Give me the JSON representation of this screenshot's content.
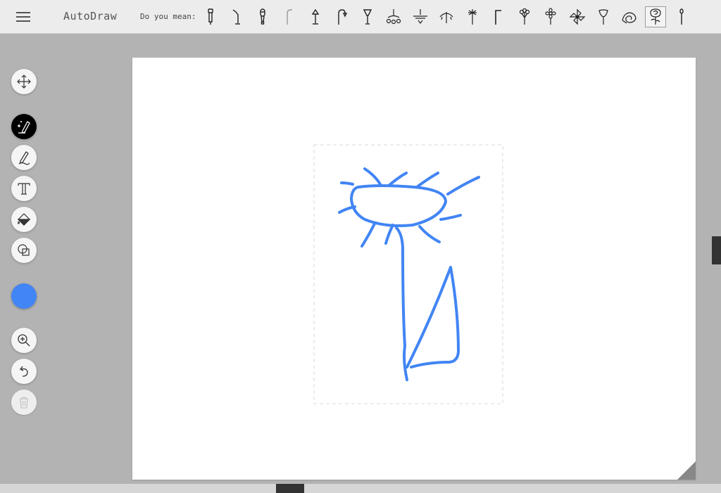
{
  "app": {
    "title": "AutoDraw"
  },
  "header": {
    "suggestions_label": "Do you mean:",
    "suggestions": [
      "flashlight",
      "desk-lamp-arm",
      "microphone",
      "street-lamp",
      "table-lamp",
      "hanging-lamp",
      "floor-lamp",
      "chandelier",
      "ceiling-fan-lamp",
      "umbrella-lamp",
      "firework",
      "angled-lamp",
      "flower-bouquet",
      "daisy-flower",
      "pinwheel-flower",
      "calla-lily",
      "spiral-rose",
      "rose",
      "match"
    ],
    "selected_index": 17
  },
  "toolbar": {
    "tools": [
      "move",
      "autodraw",
      "draw",
      "type",
      "fill",
      "shape"
    ],
    "active_tool": "autodraw",
    "color": "#4285f4",
    "actions": [
      "zoom",
      "undo",
      "delete"
    ]
  },
  "drawing": {
    "stroke_color": "#4285f4",
    "subject": "flower sketch"
  }
}
